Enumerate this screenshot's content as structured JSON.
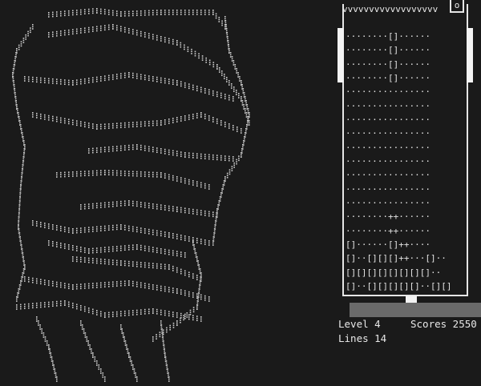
{
  "board": {
    "top_border": "vvvvvvvvvvvvvvvvvv",
    "next_piece_glyph": "o",
    "rows": [
      "········[]······",
      "········[]······",
      "········[]······",
      "········[]······",
      "················",
      "················",
      "················",
      "················",
      "················",
      "················",
      "················",
      "················",
      "················",
      "········++······",
      "········++······",
      "[]······[]++····",
      "[]··[][][]++···[]··",
      "[][][][][][][][]··",
      "[]··[][][][][]··[][]"
    ]
  },
  "hud": {
    "level_label": "Level 4",
    "scores_label": "Scores 2550",
    "lines_label": "Lines 14"
  },
  "colors": {
    "background": "#1a1a1a",
    "foreground": "#e8e8e8",
    "shadow": "#6a6a6a"
  }
}
